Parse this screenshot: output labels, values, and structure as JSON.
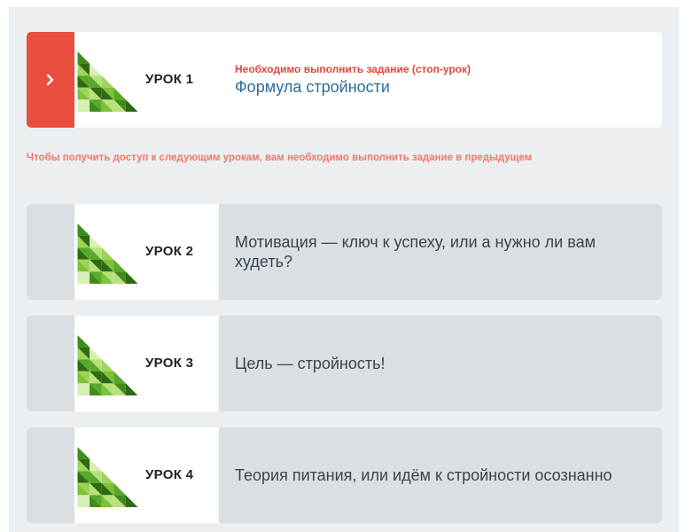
{
  "notice": "Чтобы получить доступ к следующим урокам, вам необходимо выполнить задание в предыдущем",
  "lessons": [
    {
      "number": "УРОК 1",
      "status_label": "Необходимо выполнить задание (стоп-урок)",
      "title": "Формула стройности",
      "state": "active"
    },
    {
      "number": "УРОК 2",
      "title": "Мотивация — ключ к успеху, или а нужно ли вам худеть?",
      "state": "locked"
    },
    {
      "number": "УРОК 3",
      "title": "Цель — стройность!",
      "state": "locked"
    },
    {
      "number": "УРОК 4",
      "title": "Теория питания, или идём к стройности осознанно",
      "state": "locked"
    }
  ],
  "icons": {
    "open_lesson": "chevron-right-icon",
    "thumbnail": "green-triangle-mosaic"
  },
  "colors": {
    "accent_red": "#e94e3e",
    "title_blue": "#2a6d9c",
    "locked_bg": "#d9dfe3",
    "panel_bg": "#eceff1",
    "green_dark": "#3f8c1a",
    "green_light": "#b7e07c"
  }
}
